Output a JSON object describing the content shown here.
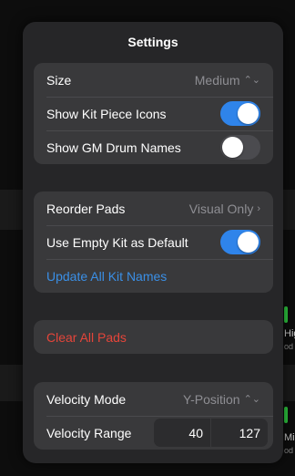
{
  "background": {
    "edge_label_1": "Hig",
    "edge_sub_1": "od",
    "edge_label_2": "Mi",
    "edge_sub_2": "od",
    "accent": "#2ecc40"
  },
  "settings": {
    "title": "Settings",
    "size": {
      "label": "Size",
      "value": "Medium"
    },
    "show_kit_piece_icons": {
      "label": "Show Kit Piece Icons",
      "on": true
    },
    "show_gm_drum_names": {
      "label": "Show GM Drum Names",
      "on": false
    },
    "reorder_pads": {
      "label": "Reorder Pads",
      "value": "Visual Only"
    },
    "use_empty_kit": {
      "label": "Use Empty Kit as Default",
      "on": true
    },
    "update_all_kit_names": "Update All Kit Names",
    "clear_all_pads": "Clear All Pads",
    "velocity_mode": {
      "label": "Velocity Mode",
      "value": "Y-Position"
    },
    "velocity_range": {
      "label": "Velocity Range",
      "min": "40",
      "max": "127"
    }
  },
  "icons": {
    "updown": "updown-chevron-icon",
    "right": "chevron-right-icon"
  },
  "colors": {
    "toggle_on": "#2f84ea",
    "link_blue": "#3a8fe6",
    "destructive_red": "#e5453a"
  }
}
